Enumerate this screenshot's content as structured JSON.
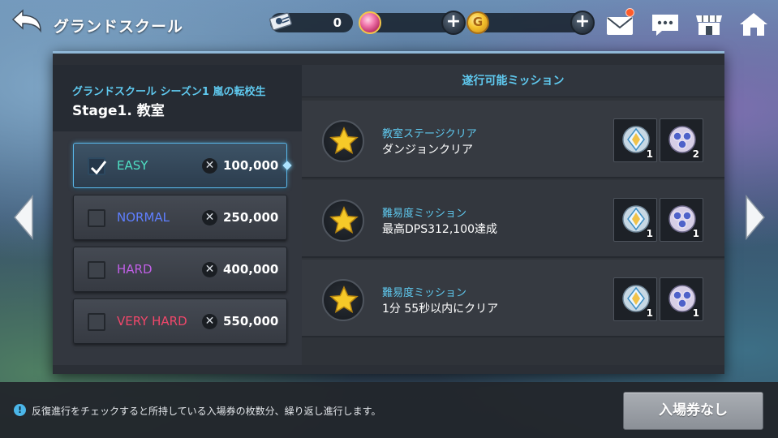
{
  "header": {
    "title": "グランドスクール",
    "back_icon": "back-arrow-icon"
  },
  "currencies": {
    "ticket": {
      "icon": "ticket-icon",
      "value": "0"
    },
    "gem": {
      "icon": "gem-icon",
      "value": ""
    },
    "gold": {
      "icon": "gold-coin-icon",
      "symbol": "G",
      "value": ""
    },
    "plus_label": "+"
  },
  "top_icons": [
    "mail-icon",
    "chat-icon",
    "shop-icon",
    "home-icon"
  ],
  "stage": {
    "season": "グランドスクール シーズン1 嵐の転校生",
    "name": "Stage1. 教室"
  },
  "difficulties": [
    {
      "label": "EASY",
      "cost": "100,000",
      "checked": true,
      "color": "#4fe0c4"
    },
    {
      "label": "NORMAL",
      "cost": "250,000",
      "checked": false,
      "color": "#5f7fff"
    },
    {
      "label": "HARD",
      "cost": "400,000",
      "checked": false,
      "color": "#c05fe6"
    },
    {
      "label": "VERY HARD",
      "cost": "550,000",
      "checked": false,
      "color": "#f0476a"
    }
  ],
  "cost_symbol": "✕",
  "missions": {
    "title": "遂行可能ミッション",
    "items": [
      {
        "category": "教室ステージクリア",
        "description": "ダンジョンクリア",
        "rewards": [
          "1",
          "2"
        ]
      },
      {
        "category": "難易度ミッション",
        "description": "最高DPS312,100達成",
        "rewards": [
          "1",
          "1"
        ]
      },
      {
        "category": "難易度ミッション",
        "description": "1分 55秒以内にクリア",
        "rewards": [
          "1",
          "1"
        ]
      }
    ]
  },
  "footer": {
    "info_icon": "!",
    "info": "反復進行をチェックすると所持している入場券の枚数分、繰り返し進行します。",
    "enter_button": "入場券なし"
  },
  "colors": {
    "accent": "#5fc9ef",
    "selected_border": "#59b6e8",
    "panel_bg": "#2b2f36"
  }
}
